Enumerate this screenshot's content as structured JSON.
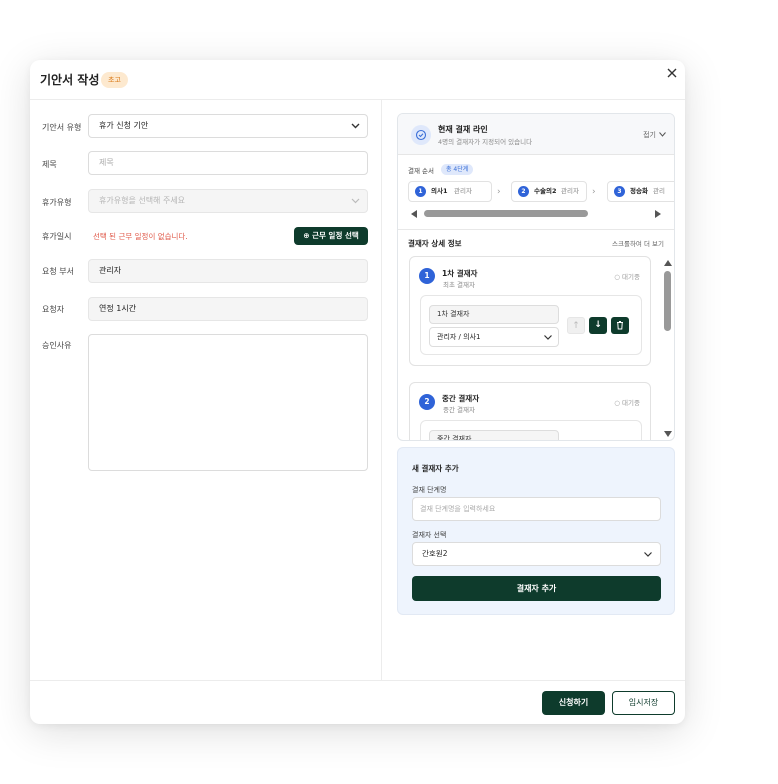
{
  "dialog": {
    "title": "기안서 작성",
    "status_badge": "초고"
  },
  "form": {
    "doc_type_label": "기안서 유형",
    "doc_type_value": "휴가 신청 기안",
    "subject_label": "제목",
    "subject_placeholder": "제목",
    "leave_type_label": "휴가유형",
    "leave_type_placeholder": "휴가유형을 선택해 주세요",
    "leave_date_label": "휴가일시",
    "leave_date_warning": "선택 된 근무 일정이 없습니다.",
    "schedule_button": "근무 일정 선택",
    "department_label": "요청 부서",
    "department_value": "관리자",
    "requester_label": "요청자",
    "requester_value": "연정 1시간",
    "reason_label": "승인사유",
    "reason_value": ""
  },
  "approval_line": {
    "title": "현재 결재 라인",
    "subtitle": "4명의 결재자가 지정되어 있습니다",
    "fold_label": "접기",
    "order_label": "결재 순서",
    "order_count": "총 4단계",
    "steps": [
      {
        "num": "1",
        "name": "의사1",
        "role": "관리자"
      },
      {
        "num": "2",
        "name": "수술의2",
        "role": "관리자"
      },
      {
        "num": "3",
        "name": "정승화",
        "role": "관리"
      }
    ],
    "detail_title": "결재자 상세 정보",
    "scroll_view": "스크롤하여 더 보기",
    "approvers": [
      {
        "num": "1",
        "title": "1차 결재자",
        "subtitle": "최초 결재자",
        "status": "대기중",
        "stage_name": "1차 결재자",
        "approver": "관리자 / 의사1"
      },
      {
        "num": "2",
        "title": "중간 결재자",
        "subtitle": "중간 결재자",
        "status": "대기중",
        "stage_name": "중간 결재자"
      }
    ]
  },
  "add_approver": {
    "title": "새 결재자 추가",
    "stage_label": "결재 단계명",
    "stage_placeholder": "결재 단계명을 입력하세요",
    "approver_label": "결재자 선택",
    "approver_value": "간호원2",
    "add_button": "결재자 추가"
  },
  "footer": {
    "submit_button": "신청하기",
    "temp_save_button": "임시저장"
  },
  "colors": {
    "primary": "#0e3b2c",
    "accent_blue": "#2f63d8",
    "badge_orange": "#d97a1a",
    "warning_red": "#e05a4a",
    "panel_bg": "#eef4fd"
  }
}
